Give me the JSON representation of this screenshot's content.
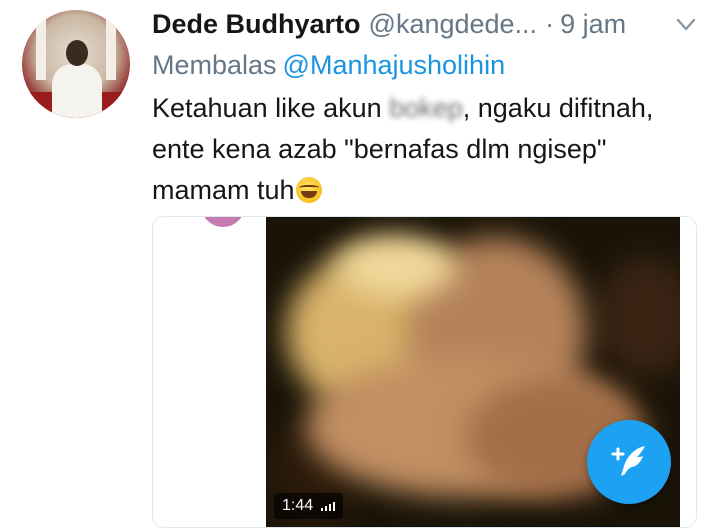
{
  "tweet": {
    "author_name": "Dede Budhyarto",
    "handle": "@kangdede...",
    "separator": "·",
    "time_ago": "9 jam",
    "reply_prefix": "Membalas",
    "reply_to": "@Manhajusholihin",
    "text_part1": "Ketahuan like akun ",
    "text_censored": "bokep",
    "text_part2": ", ngaku difitnah, ente kena azab \"bernafas dlm ngisep\" mamam tuh",
    "emoji": "face-with-tears-of-joy-icon"
  },
  "media": {
    "duration": "1:44"
  },
  "colors": {
    "link": "#1b95e0",
    "secondary_text": "#657786",
    "fab": "#1da1f2"
  }
}
